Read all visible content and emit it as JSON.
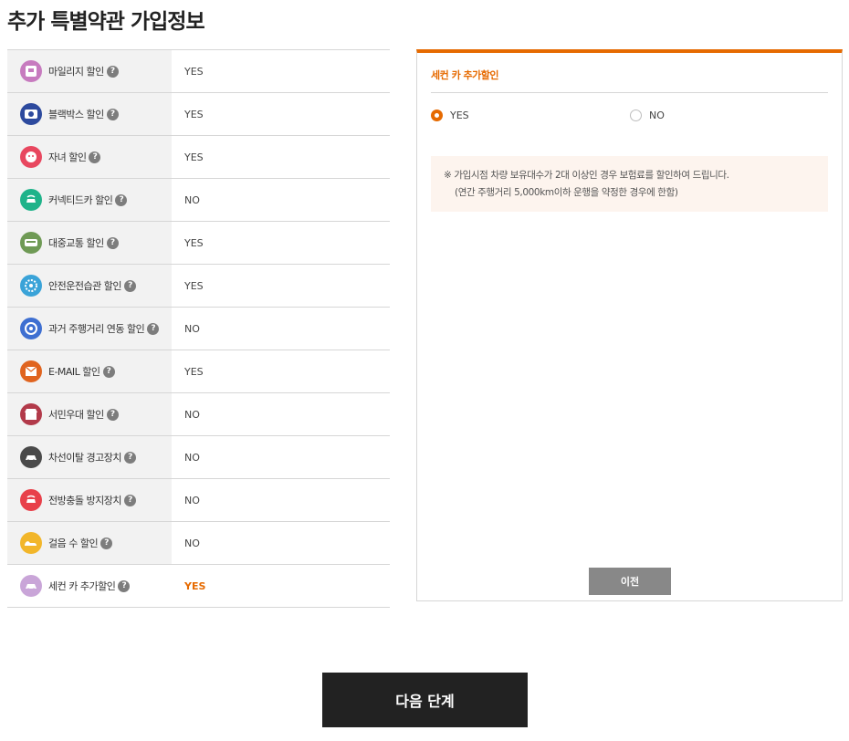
{
  "page": {
    "title": "추가 특별약관 가입정보"
  },
  "help_glyph": "?",
  "discounts": [
    {
      "label": "마일리지 할인",
      "value": "YES",
      "icon": "mileage-icon",
      "color": "#c77bbf"
    },
    {
      "label": "블랙박스 할인",
      "value": "YES",
      "icon": "blackbox-icon",
      "color": "#2d4a9e"
    },
    {
      "label": "자녀 할인",
      "value": "YES",
      "icon": "child-icon",
      "color": "#e8475f"
    },
    {
      "label": "커넥티드카 할인",
      "value": "NO",
      "icon": "connected-car-icon",
      "color": "#1fb38a"
    },
    {
      "label": "대중교통 할인",
      "value": "YES",
      "icon": "bus-icon",
      "color": "#6f9a55"
    },
    {
      "label": "안전운전습관 할인",
      "value": "YES",
      "icon": "safe-driving-icon",
      "color": "#3aa3d8"
    },
    {
      "label": "과거 주행거리 연동 할인",
      "value": "NO",
      "icon": "odometer-icon",
      "color": "#3e6fd1"
    },
    {
      "label": "E-MAIL 할인",
      "value": "YES",
      "icon": "email-icon",
      "color": "#e0641f"
    },
    {
      "label": "서민우대 할인",
      "value": "NO",
      "icon": "store-icon",
      "color": "#b23a4a"
    },
    {
      "label": "차선이탈 경고장치",
      "value": "NO",
      "icon": "lane-departure-icon",
      "color": "#4a4a4a"
    },
    {
      "label": "전방충돌 방지장치",
      "value": "NO",
      "icon": "collision-icon",
      "color": "#e8404a"
    },
    {
      "label": "걸음 수 할인",
      "value": "NO",
      "icon": "shoe-icon",
      "color": "#f2b62a"
    },
    {
      "label": "세컨 카 추가할인",
      "value": "YES",
      "icon": "second-car-icon",
      "color": "#c9a5d8"
    }
  ],
  "panel": {
    "title": "세컨 카 추가할인",
    "options": [
      {
        "label": "YES",
        "selected": true
      },
      {
        "label": "NO",
        "selected": false
      }
    ],
    "notice_line1": "※ 가입시점 차량 보유대수가 2대 이상인 경우 보험료를 할인하여 드립니다.",
    "notice_line2": "(연간 주행거리 5,000km이하 운행을 약정한 경우에 한함)",
    "prev_button": "이전"
  },
  "next_button": "다음 단계",
  "accent_color": "#e66a00"
}
